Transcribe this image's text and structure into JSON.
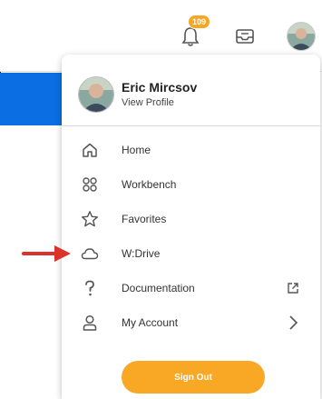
{
  "header": {
    "notification_count": "109"
  },
  "profile": {
    "name": "Eric Mircsov",
    "link_label": "View Profile"
  },
  "menu": [
    {
      "label": "Home",
      "icon": "home-icon"
    },
    {
      "label": "Workbench",
      "icon": "workbench-icon"
    },
    {
      "label": "Favorites",
      "icon": "star-icon"
    },
    {
      "label": "W:Drive",
      "icon": "cloud-icon"
    },
    {
      "label": "Documentation",
      "icon": "question-icon",
      "trail": "external-link-icon"
    },
    {
      "label": "My Account",
      "icon": "user-icon",
      "trail": "chevron-right-icon"
    }
  ],
  "signout_label": "Sign Out",
  "colors": {
    "accent_orange": "#f9a825",
    "band_blue": "#0b6fe3",
    "arrow_red": "#d9332a"
  }
}
